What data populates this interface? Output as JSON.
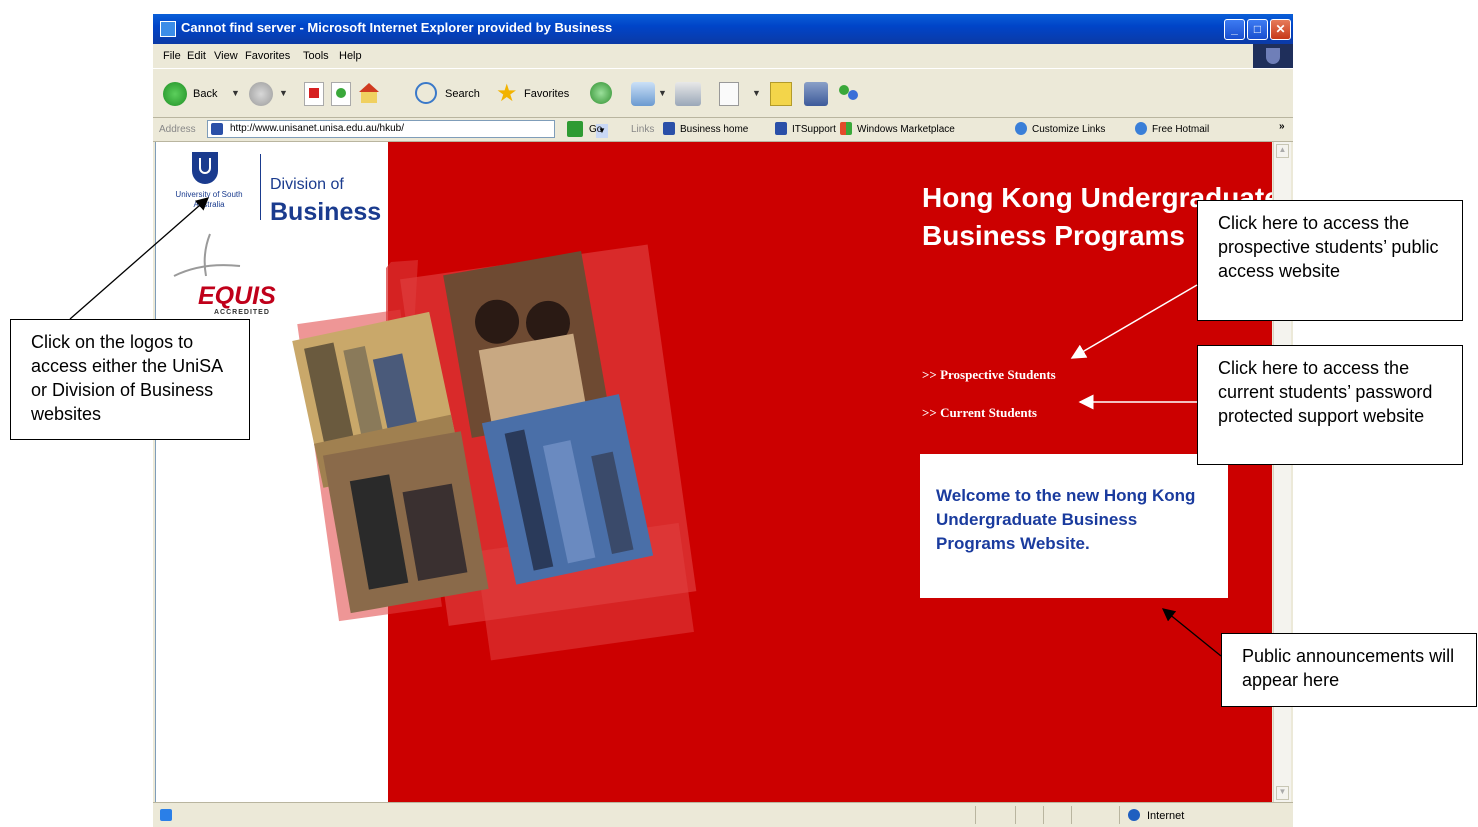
{
  "window": {
    "title": "Cannot find server - Microsoft Internet Explorer provided by Business",
    "minimize": "_",
    "maximize": "□",
    "close": "✕"
  },
  "menu": [
    "File",
    "Edit",
    "View",
    "Favorites",
    "Tools",
    "Help"
  ],
  "toolbar": {
    "back_label": "Back",
    "search_label": "Search",
    "favorites_label": "Favorites",
    "icons": [
      "back-icon",
      "forward-icon",
      "stop-icon",
      "refresh-icon",
      "home-icon",
      "search-icon",
      "favorites-star-icon",
      "history-icon",
      "mail-icon",
      "print-icon",
      "edit-icon",
      "discuss-icon",
      "research-icon",
      "messenger-icon"
    ]
  },
  "address": {
    "label": "Address",
    "value": "http://www.unisanet.unisa.edu.au/hkub/",
    "go_label": "Go",
    "links_label": "Links",
    "links": [
      "Business home",
      "ITSupport",
      "Windows Marketplace",
      "Customize Links",
      "Free Hotmail"
    ],
    "more": "»"
  },
  "page": {
    "unisa_text": "University of South Australia",
    "division_of": "Division of",
    "business": "Business",
    "equis": "EQUIS",
    "equis_sub": "ACCREDITED",
    "hero_title": "Hong Kong Undergraduate Business Programs",
    "prospective_link": ">> Prospective Students",
    "current_link": ">> Current Students",
    "announcement": "Welcome to the new Hong Kong Undergraduate Business Programs Website."
  },
  "status": {
    "zone": "Internet"
  },
  "callouts": {
    "logos": "Click on the logos to access either the UniSA or Division of Business websites",
    "prospective": "Click here to access the prospective students’ public access website",
    "current": "Click here to access the current students’ password protected support website",
    "announcements": "Public announcements will appear here"
  },
  "colors": {
    "brand_red": "#cc0000",
    "brand_blue": "#1a3b8e",
    "titlebar_blue": "#0044c8"
  }
}
